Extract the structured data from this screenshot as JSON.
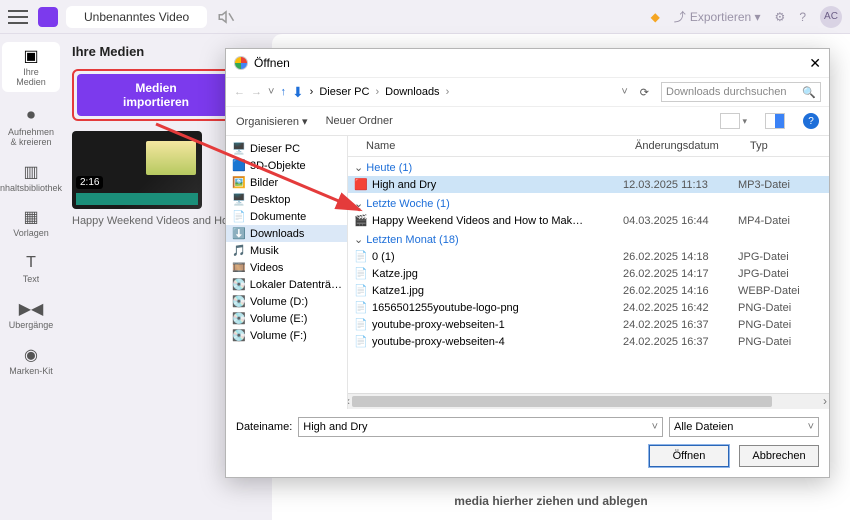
{
  "top": {
    "title": "Unbenanntes Video",
    "export_label": "Exportieren",
    "user_initials": "AC"
  },
  "rail": [
    {
      "label": "Ihre\nMedien"
    },
    {
      "label": "Aufnehmen\n& kreieren"
    },
    {
      "label": "nhaltsbibliothek"
    },
    {
      "label": "Vorlagen"
    },
    {
      "label": "Text"
    },
    {
      "label": "Übergänge"
    },
    {
      "label": "Marken-Kit"
    }
  ],
  "panel": {
    "heading": "Ihre Medien",
    "import_line1": "Medien",
    "import_line2": "importieren",
    "thumb_duration": "2:16",
    "thumb_title": "Happy Weekend Videos and How…"
  },
  "drop_hint": "media hierher ziehen und ablegen",
  "dialog": {
    "title": "Öffnen",
    "crumbs": [
      "Dieser PC",
      "Downloads"
    ],
    "search_placeholder": "Downloads durchsuchen",
    "toolbar": {
      "organize": "Organisieren",
      "new_folder": "Neuer Ordner"
    },
    "tree": [
      {
        "icon": "🖥️",
        "label": "Dieser PC"
      },
      {
        "icon": "🟦",
        "label": "3D-Objekte"
      },
      {
        "icon": "🖼️",
        "label": "Bilder"
      },
      {
        "icon": "🖥️",
        "label": "Desktop"
      },
      {
        "icon": "📄",
        "label": "Dokumente"
      },
      {
        "icon": "⬇️",
        "label": "Downloads",
        "selected": true
      },
      {
        "icon": "🎵",
        "label": "Musik"
      },
      {
        "icon": "🎞️",
        "label": "Videos"
      },
      {
        "icon": "💽",
        "label": "Lokaler Datenträ…"
      },
      {
        "icon": "💽",
        "label": "Volume (D:)"
      },
      {
        "icon": "💽",
        "label": "Volume (E:)"
      },
      {
        "icon": "💽",
        "label": "Volume (F:)"
      }
    ],
    "columns": {
      "name": "Name",
      "date": "Änderungsdatum",
      "type": "Typ"
    },
    "groups": [
      {
        "title": "Heute (1)",
        "rows": [
          {
            "icon": "🟥",
            "name": "High and Dry",
            "date": "12.03.2025 11:13",
            "type": "MP3-Datei",
            "selected": true
          }
        ]
      },
      {
        "title": "Letzte Woche (1)",
        "rows": [
          {
            "icon": "🎬",
            "name": "Happy Weekend Videos and How to Mak…",
            "date": "04.03.2025 16:44",
            "type": "MP4-Datei"
          }
        ]
      },
      {
        "title": "Letzten Monat (18)",
        "rows": [
          {
            "icon": "📄",
            "name": "0 (1)",
            "date": "26.02.2025 14:18",
            "type": "JPG-Datei"
          },
          {
            "icon": "📄",
            "name": "Katze.jpg",
            "date": "26.02.2025 14:17",
            "type": "JPG-Datei"
          },
          {
            "icon": "📄",
            "name": "Katze1.jpg",
            "date": "26.02.2025 14:16",
            "type": "WEBP-Datei"
          },
          {
            "icon": "📄",
            "name": "1656501255youtube-logo-png",
            "date": "24.02.2025 16:42",
            "type": "PNG-Datei"
          },
          {
            "icon": "📄",
            "name": "youtube-proxy-webseiten-1",
            "date": "24.02.2025 16:37",
            "type": "PNG-Datei"
          },
          {
            "icon": "📄",
            "name": "youtube-proxy-webseiten-4",
            "date": "24.02.2025 16:37",
            "type": "PNG-Datei"
          }
        ]
      }
    ],
    "filename_label": "Dateiname:",
    "filename_value": "High and Dry",
    "filter_value": "Alle Dateien",
    "btn_open": "Öffnen",
    "btn_cancel": "Abbrechen"
  }
}
